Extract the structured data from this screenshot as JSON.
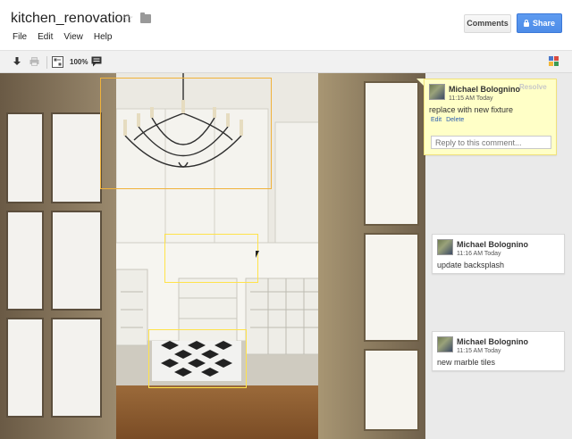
{
  "document": {
    "title": "kitchen_renovation"
  },
  "menu": {
    "items": [
      "File",
      "Edit",
      "View",
      "Help"
    ]
  },
  "header": {
    "comments_label": "Comments",
    "share_label": "Share"
  },
  "toolbar": {
    "zoom_label": "100%"
  },
  "comments": [
    {
      "author": "Michael Bolognino",
      "time": "11:15 AM Today",
      "text": "replace with new fixture",
      "edit_label": "Edit",
      "delete_label": "Delete",
      "resolve_label": "Resolve",
      "reply_placeholder": "Reply to this comment..."
    },
    {
      "author": "Michael Bolognino",
      "time": "11:16 AM Today",
      "text": "update backsplash"
    },
    {
      "author": "Michael Bolognino",
      "time": "11:15 AM Today",
      "text": "new marble tiles"
    }
  ],
  "colors": {
    "share": "#4d8ce8",
    "highlight": "#ffe34a",
    "active_highlight": "#f0b23a",
    "active_comment_bg": "#ffffc7"
  },
  "icons": [
    "star-icon",
    "folder-icon",
    "download-icon",
    "print-icon",
    "fit-icon",
    "comment-icon",
    "lock-icon",
    "app-icon"
  ]
}
